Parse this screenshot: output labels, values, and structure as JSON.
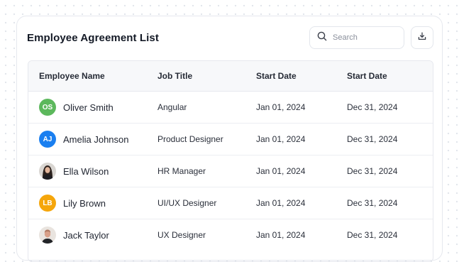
{
  "title": "Employee Agreement List",
  "search": {
    "placeholder": "Search",
    "icon": "search-icon"
  },
  "download": {
    "icon": "download-icon"
  },
  "columns": [
    "Employee Name",
    "Job Title",
    "Start Date",
    "Start Date"
  ],
  "rows": [
    {
      "initials": "OS",
      "avatar_color": "#5cb85c",
      "name": "Oliver Smith",
      "job": "Angular",
      "start": "Jan 01, 2024",
      "end": "Dec 31, 2024"
    },
    {
      "initials": "AJ",
      "avatar_color": "#1a7ff0",
      "name": "Amelia Johnson",
      "job": "Product Designer",
      "start": "Jan 01, 2024",
      "end": "Dec 31, 2024"
    },
    {
      "initials": "",
      "avatar_color": "#5a4a44",
      "name": "Ella Wilson",
      "job": "HR Manager",
      "start": "Jan 01, 2024",
      "end": "Dec 31, 2024"
    },
    {
      "initials": "LB",
      "avatar_color": "#f5a60b",
      "name": "Lily Brown",
      "job": "UI/UX Designer",
      "start": "Jan 01, 2024",
      "end": "Dec 31, 2024"
    },
    {
      "initials": "",
      "avatar_color": "#d9a089",
      "name": "Jack Taylor",
      "job": "UX Designer",
      "start": "Jan 01, 2024",
      "end": "Dec 31, 2024"
    }
  ]
}
